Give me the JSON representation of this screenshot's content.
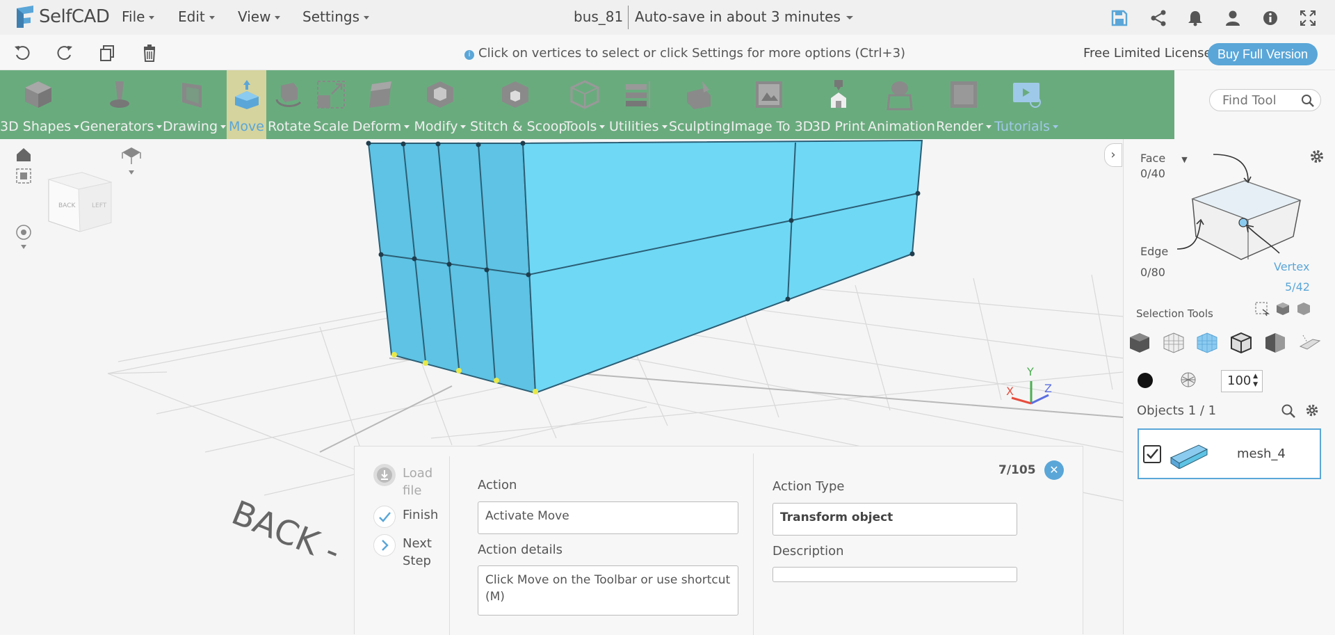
{
  "app": {
    "name": "SelfCAD"
  },
  "menu": {
    "file": "File",
    "edit": "Edit",
    "view": "View",
    "settings": "Settings"
  },
  "document": {
    "title": "bus_81",
    "autosave": "Auto-save in about 3 minutes"
  },
  "hint": {
    "text": "Click on vertices to select or click Settings for more options (Ctrl+3)"
  },
  "license": {
    "label": "Free Limited License",
    "buy": "Buy Full Version"
  },
  "toolbar": {
    "tools": [
      {
        "label": "3D Shapes",
        "icon": "cube-icon"
      },
      {
        "label": "Generators",
        "icon": "generator-icon"
      },
      {
        "label": "Drawing",
        "icon": "drawing-icon"
      },
      {
        "label": "Move",
        "icon": "move-icon"
      },
      {
        "label": "Rotate",
        "icon": "rotate-icon"
      },
      {
        "label": "Scale",
        "icon": "scale-icon"
      },
      {
        "label": "Deform",
        "icon": "deform-icon"
      },
      {
        "label": "Modify",
        "icon": "modify-icon"
      },
      {
        "label": "Stitch & Scoop",
        "icon": "stitch-icon"
      },
      {
        "label": "Tools",
        "icon": "tools-icon"
      },
      {
        "label": "Utilities",
        "icon": "utilities-icon"
      },
      {
        "label": "Sculpting",
        "icon": "sculpting-icon"
      },
      {
        "label": "Image To 3D",
        "icon": "image-to-3d-icon"
      },
      {
        "label": "3D Print",
        "icon": "print-icon"
      },
      {
        "label": "Animation",
        "icon": "animation-icon"
      },
      {
        "label": "Render",
        "icon": "render-icon"
      },
      {
        "label": "Tutorials",
        "icon": "tutorials-icon"
      }
    ],
    "find_placeholder": "Find Tool"
  },
  "colors": {
    "accent": "#5aa6d8",
    "toolbar": "#6aab7e",
    "active_tool": "#d5d49e",
    "mesh": "#6fd8f5"
  },
  "viewport": {
    "floor_label": "BACK -",
    "cube_back": "BACK",
    "cube_left": "LEFT",
    "axis_x": "X",
    "axis_y": "Y",
    "axis_z": "Z"
  },
  "selection": {
    "face_label": "Face",
    "face_count": "0/40",
    "edge_label": "Edge",
    "edge_count": "0/80",
    "vertex_label": "Vertex",
    "vertex_count": "5/42",
    "tools_label": "Selection Tools",
    "opacity": "100"
  },
  "objects": {
    "header": "Objects 1 / 1",
    "items": [
      {
        "name": "mesh_4",
        "checked": true
      }
    ]
  },
  "dialog": {
    "progress": "7/105",
    "steps": {
      "load": "Load file",
      "finish": "Finish",
      "next": "Next Step"
    },
    "action_label": "Action",
    "action_value": "Activate Move",
    "action_details_label": "Action details",
    "action_details_value": "Click Move on the Toolbar or use shortcut (M)",
    "action_type_label": "Action Type",
    "action_type_value": "Transform object",
    "description_label": "Description",
    "description_value": ""
  }
}
